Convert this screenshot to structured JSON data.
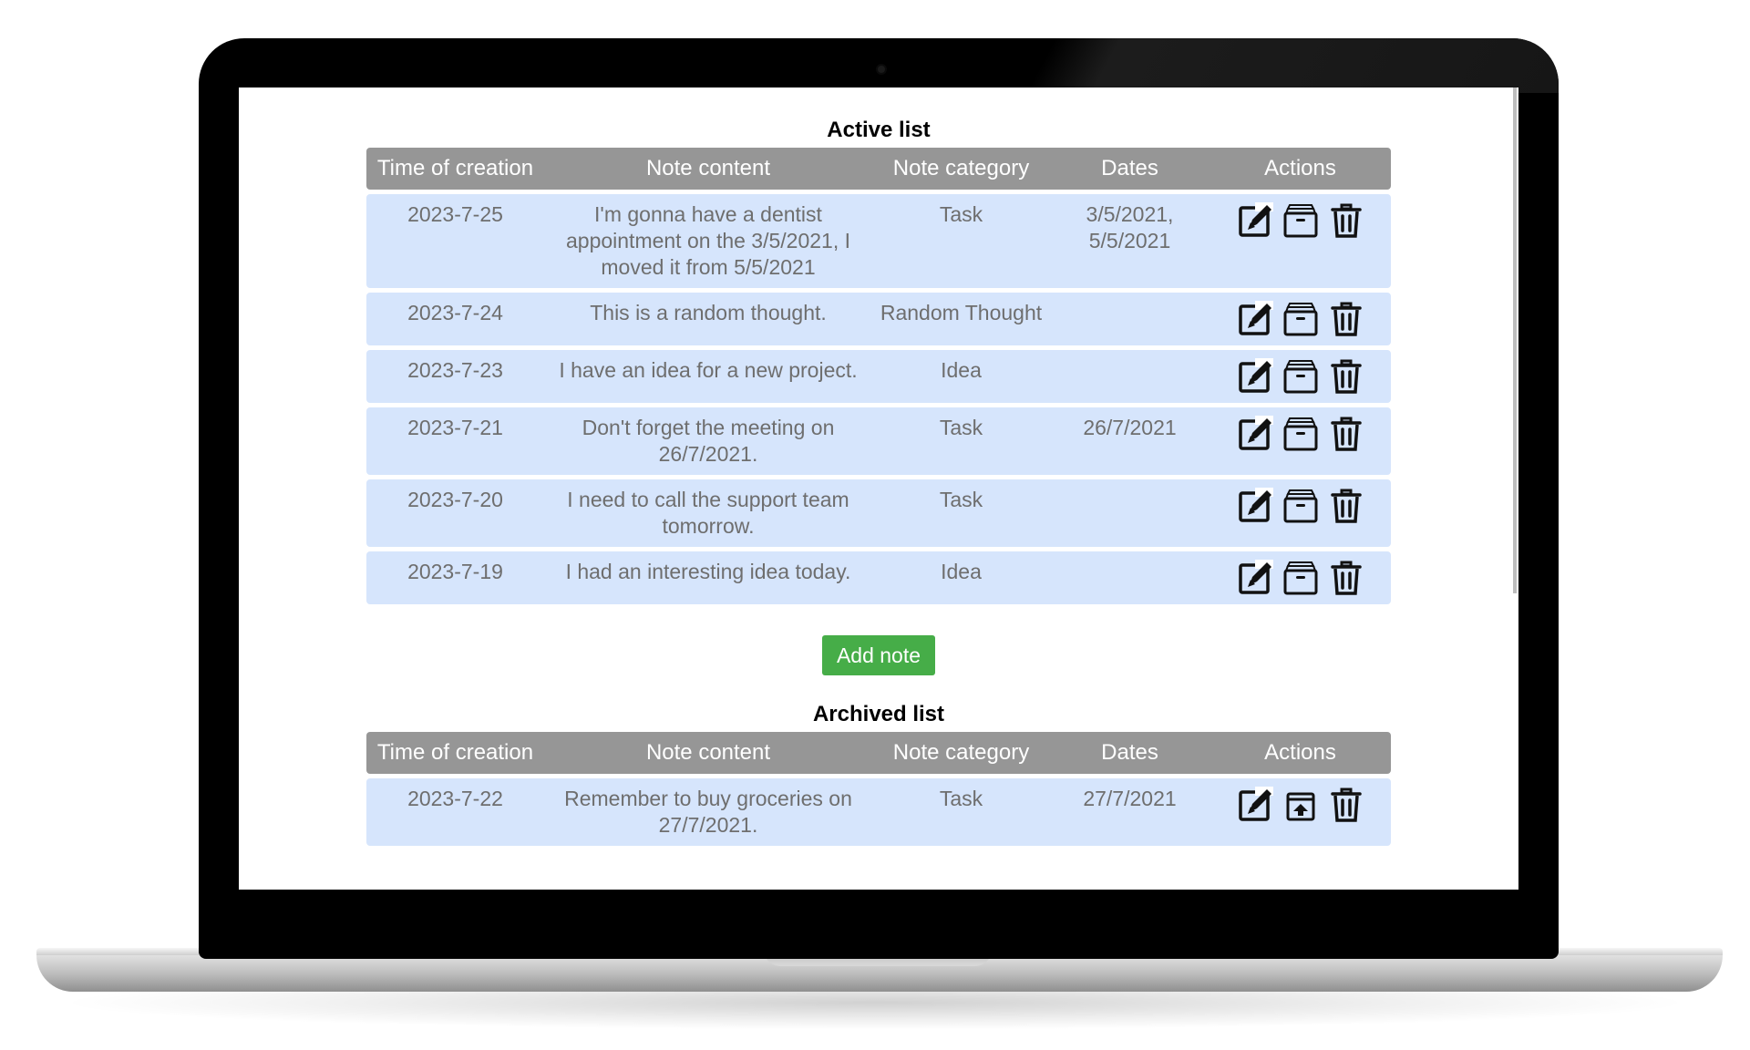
{
  "active": {
    "title": "Active list",
    "headers": [
      "Time of creation",
      "Note content",
      "Note category",
      "Dates",
      "Actions"
    ],
    "rows": [
      {
        "time": "2023-7-25",
        "content": "I'm gonna have a dentist appointment on the 3/5/2021, I moved it from 5/5/2021",
        "category": "Task",
        "dates": "3/5/2021, 5/5/2021"
      },
      {
        "time": "2023-7-24",
        "content": "This is a random thought.",
        "category": "Random Thought",
        "dates": ""
      },
      {
        "time": "2023-7-23",
        "content": "I have an idea for a new project.",
        "category": "Idea",
        "dates": ""
      },
      {
        "time": "2023-7-21",
        "content": "Don't forget the meeting on 26/7/2021.",
        "category": "Task",
        "dates": "26/7/2021"
      },
      {
        "time": "2023-7-20",
        "content": "I need to call the support team tomorrow.",
        "category": "Task",
        "dates": ""
      },
      {
        "time": "2023-7-19",
        "content": "I had an interesting idea today.",
        "category": "Idea",
        "dates": ""
      }
    ]
  },
  "add_button": {
    "label": "Add note"
  },
  "archived": {
    "title": "Archived list",
    "headers": [
      "Time of creation",
      "Note content",
      "Note category",
      "Dates",
      "Actions"
    ],
    "rows": [
      {
        "time": "2023-7-22",
        "content": "Remember to buy groceries on 27/7/2021.",
        "category": "Task",
        "dates": "27/7/2021"
      }
    ]
  },
  "icons": {
    "edit": "edit-icon",
    "archive": "archive-icon",
    "unarchive": "unarchive-icon",
    "delete": "trash-icon"
  },
  "colors": {
    "header_bg": "#969696",
    "row_bg": "#d6e5fc",
    "add_button": "#46ad48"
  }
}
